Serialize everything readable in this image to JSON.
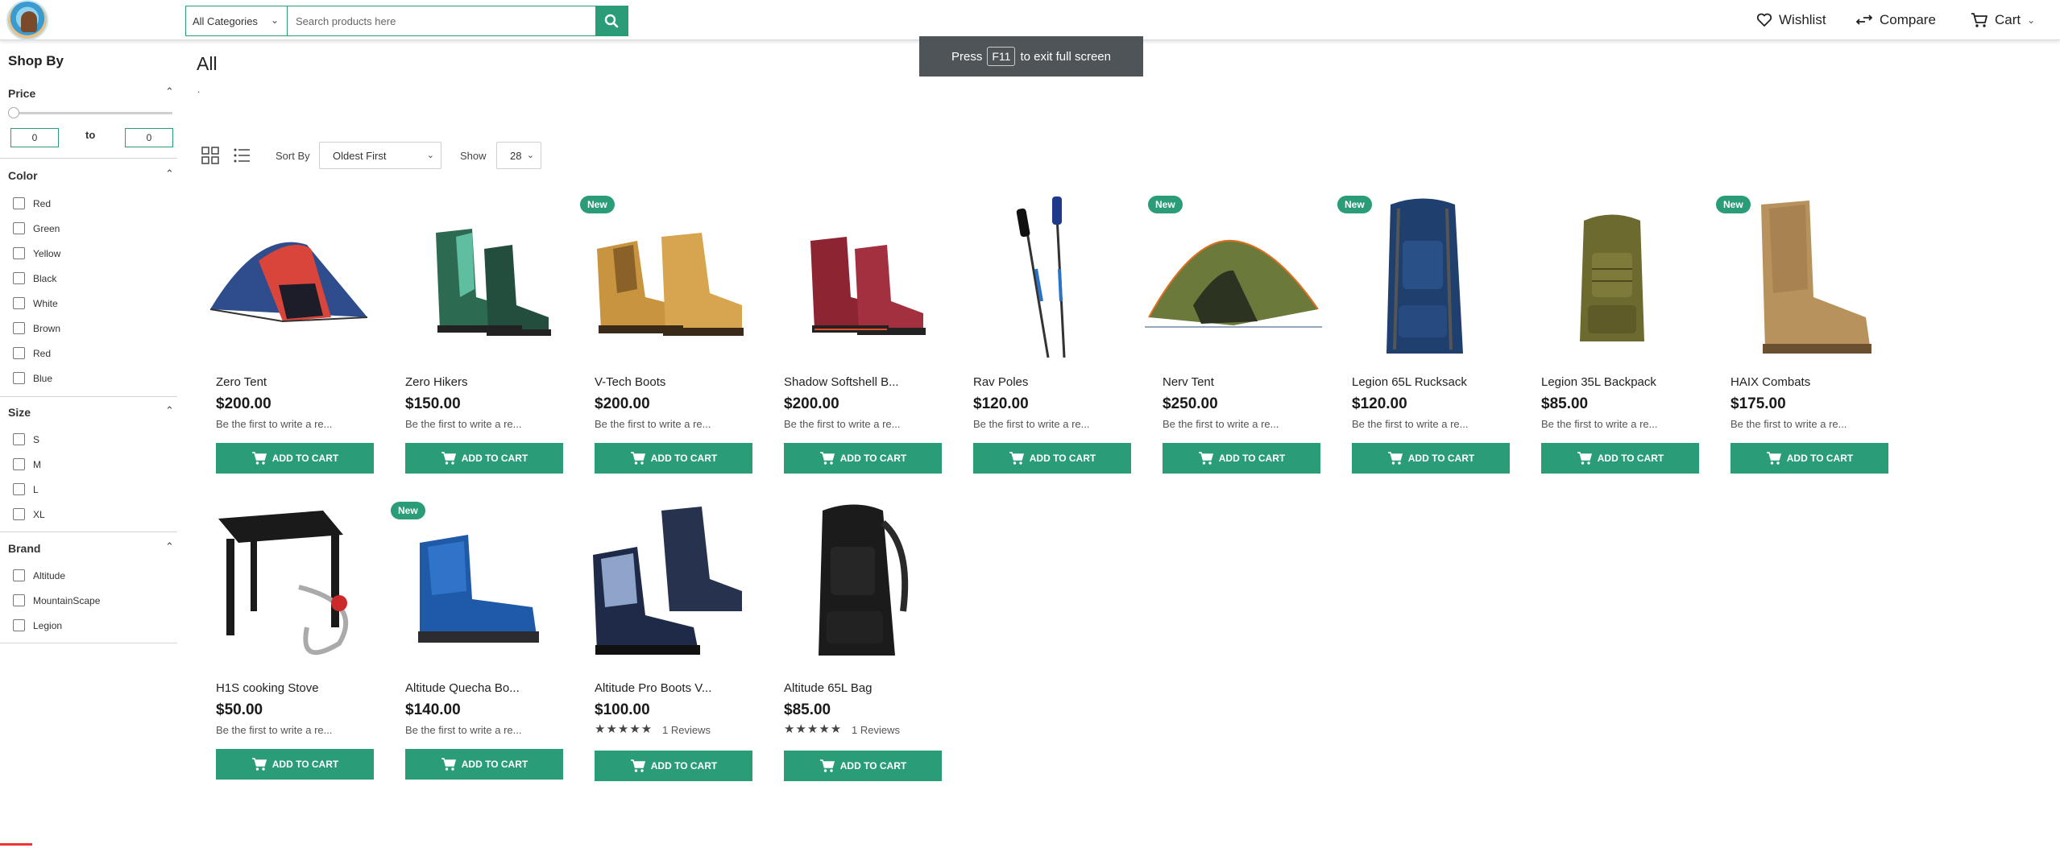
{
  "header": {
    "search_category": "All Categories",
    "search_placeholder": "Search products here",
    "wishlist_label": "Wishlist",
    "compare_label": "Compare",
    "cart_label": "Cart",
    "accent_color": "#2a9d78"
  },
  "fullscreen_toast": {
    "pre": "Press",
    "key": "F11",
    "post": "to exit full screen"
  },
  "sidebar": {
    "title": "Shop By",
    "price": {
      "title": "Price",
      "min_value": "0",
      "max_value": "0",
      "to_label": "to"
    },
    "color": {
      "title": "Color",
      "options": [
        "Red",
        "Green",
        "Yellow",
        "Black",
        "White",
        "Brown",
        "Red",
        "Blue"
      ]
    },
    "size": {
      "title": "Size",
      "options": [
        "S",
        "M",
        "L",
        "XL"
      ]
    },
    "brand": {
      "title": "Brand",
      "options": [
        "Altitude",
        "MountainScape",
        "Legion"
      ]
    },
    "collapse_icon": "chevron-up-icon"
  },
  "main": {
    "title": "All",
    "subtitle": ".",
    "sort_label": "Sort By",
    "sort_value": "Oldest First",
    "show_label": "Show",
    "show_value": "28"
  },
  "products": [
    {
      "name": "Zero Tent",
      "price": "$200.00",
      "review": "Be the first to write a re...",
      "badge": "",
      "stars": "",
      "reviews_count": "",
      "cart_label": "ADD TO CART"
    },
    {
      "name": "Zero Hikers",
      "price": "$150.00",
      "review": "Be the first to write a re...",
      "badge": "",
      "stars": "",
      "reviews_count": "",
      "cart_label": "ADD TO CART"
    },
    {
      "name": "V-Tech Boots",
      "price": "$200.00",
      "review": "Be the first to write a re...",
      "badge": "New",
      "stars": "",
      "reviews_count": "",
      "cart_label": "ADD TO CART"
    },
    {
      "name": "Shadow Softshell B...",
      "price": "$200.00",
      "review": "Be the first to write a re...",
      "badge": "",
      "stars": "",
      "reviews_count": "",
      "cart_label": "ADD TO CART"
    },
    {
      "name": "Rav Poles",
      "price": "$120.00",
      "review": "Be the first to write a re...",
      "badge": "",
      "stars": "",
      "reviews_count": "",
      "cart_label": "ADD TO CART"
    },
    {
      "name": "Nerv Tent",
      "price": "$250.00",
      "review": "Be the first to write a re...",
      "badge": "New",
      "stars": "",
      "reviews_count": "",
      "cart_label": "ADD TO CART"
    },
    {
      "name": "Legion 65L Rucksack",
      "price": "$120.00",
      "review": "Be the first to write a re...",
      "badge": "New",
      "stars": "",
      "reviews_count": "",
      "cart_label": "ADD TO CART"
    },
    {
      "name": "Legion 35L Backpack",
      "price": "$85.00",
      "review": "Be the first to write a re...",
      "badge": "",
      "stars": "",
      "reviews_count": "",
      "cart_label": "ADD TO CART"
    },
    {
      "name": "HAIX Combats",
      "price": "$175.00",
      "review": "Be the first to write a re...",
      "badge": "New",
      "stars": "",
      "reviews_count": "",
      "cart_label": "ADD TO CART"
    },
    {
      "name": "H1S cooking Stove",
      "price": "$50.00",
      "review": "Be the first to write a re...",
      "badge": "",
      "stars": "",
      "reviews_count": "",
      "cart_label": "ADD TO CART"
    },
    {
      "name": "Altitude Quecha Bo...",
      "price": "$140.00",
      "review": "Be the first to write a re...",
      "badge": "New",
      "stars": "",
      "reviews_count": "",
      "cart_label": "ADD TO CART"
    },
    {
      "name": "Altitude Pro Boots V...",
      "price": "$100.00",
      "review": "",
      "badge": "",
      "stars": "★★★★★",
      "reviews_count": "1 Reviews",
      "cart_label": "ADD TO CART"
    },
    {
      "name": "Altitude 65L Bag",
      "price": "$85.00",
      "review": "",
      "badge": "",
      "stars": "★★★★★",
      "reviews_count": "1 Reviews",
      "cart_label": "ADD TO CART"
    }
  ]
}
